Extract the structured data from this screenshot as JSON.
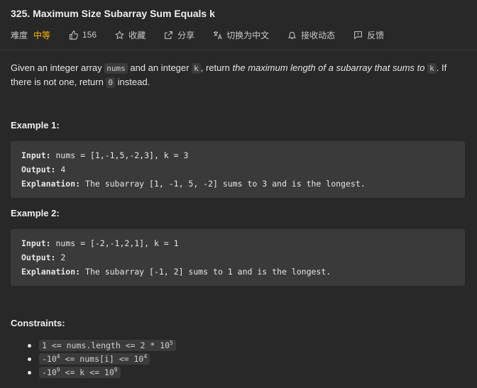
{
  "problem": {
    "title": "325. Maximum Size Subarray Sum Equals k"
  },
  "meta": {
    "difficulty_label": "难度",
    "difficulty_value": "中等",
    "difficulty_color": "#ffb800",
    "likes": "156",
    "favorite": "收藏",
    "share": "分享",
    "translate": "切换为中文",
    "notify": "接收动态",
    "feedback": "反馈",
    "icons": [
      "thumbs-up-icon",
      "star-icon",
      "share-icon",
      "translate-icon",
      "bell-icon",
      "feedback-icon"
    ]
  },
  "description": {
    "part1": "Given an integer array ",
    "code_nums": "nums",
    "part2": " and an integer ",
    "code_k": "k",
    "part3": ", return ",
    "emphasis": "the maximum length of a subarray that sums to",
    "part4": " ",
    "code_k2": "k",
    "part5": ". If there is not one, return ",
    "code_zero": "0",
    "part6": " instead."
  },
  "examples": [
    {
      "heading": "Example 1:",
      "input_label": "Input:",
      "input_value": " nums = [1,-1,5,-2,3], k = 3",
      "output_label": "Output:",
      "output_value": " 4",
      "explanation_label": "Explanation:",
      "explanation_value": " The subarray [1, -1, 5, -2] sums to 3 and is the longest."
    },
    {
      "heading": "Example 2:",
      "input_label": "Input:",
      "input_value": " nums = [-2,-1,2,1], k = 1",
      "output_label": "Output:",
      "output_value": " 2",
      "explanation_label": "Explanation:",
      "explanation_value": " The subarray [-1, 2] sums to 1 and is the longest."
    }
  ],
  "constraints": {
    "heading": "Constraints:",
    "c1_text": "1 <= nums.length <= 2 * 10",
    "c1_exp": "5",
    "c2_pre": "-10",
    "c2_exp1": "4",
    "c2_mid": " <= nums[i] <= 10",
    "c2_exp2": "4",
    "c3_pre": "-10",
    "c3_exp1": "9",
    "c3_mid": " <= k <= 10",
    "c3_exp2": "9"
  }
}
